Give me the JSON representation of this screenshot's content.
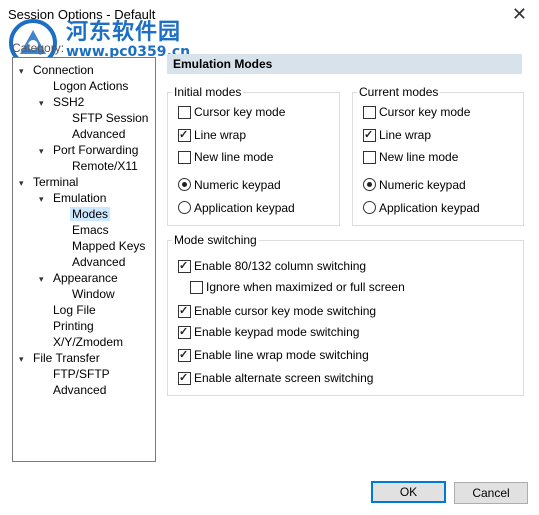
{
  "window": {
    "title": "Session Options - Default",
    "close_glyph": "✕"
  },
  "watermark": {
    "line1": "河东软件园",
    "line2": "www.pc0359.cn"
  },
  "category": {
    "label": "Category:",
    "items": [
      {
        "label": "Connection",
        "level": 0,
        "expander": "▾",
        "selected": false
      },
      {
        "label": "Logon Actions",
        "level": 1,
        "expander": "",
        "selected": false
      },
      {
        "label": "SSH2",
        "level": 1,
        "expander": "▾",
        "selected": false
      },
      {
        "label": "SFTP Session",
        "level": 2,
        "expander": "",
        "selected": false
      },
      {
        "label": "Advanced",
        "level": 2,
        "expander": "",
        "selected": false
      },
      {
        "label": "Port Forwarding",
        "level": 1,
        "expander": "▾",
        "selected": false
      },
      {
        "label": "Remote/X11",
        "level": 2,
        "expander": "",
        "selected": false
      },
      {
        "label": "Terminal",
        "level": 0,
        "expander": "▾",
        "selected": false
      },
      {
        "label": "Emulation",
        "level": 1,
        "expander": "▾",
        "selected": false
      },
      {
        "label": "Modes",
        "level": 2,
        "expander": "",
        "selected": true
      },
      {
        "label": "Emacs",
        "level": 2,
        "expander": "",
        "selected": false
      },
      {
        "label": "Mapped Keys",
        "level": 2,
        "expander": "",
        "selected": false
      },
      {
        "label": "Advanced",
        "level": 2,
        "expander": "",
        "selected": false
      },
      {
        "label": "Appearance",
        "level": 1,
        "expander": "▾",
        "selected": false
      },
      {
        "label": "Window",
        "level": 2,
        "expander": "",
        "selected": false
      },
      {
        "label": "Log File",
        "level": 1,
        "expander": "",
        "selected": false
      },
      {
        "label": "Printing",
        "level": 1,
        "expander": "",
        "selected": false
      },
      {
        "label": "X/Y/Zmodem",
        "level": 1,
        "expander": "",
        "selected": false
      },
      {
        "label": "File Transfer",
        "level": 0,
        "expander": "▾",
        "selected": false
      },
      {
        "label": "FTP/SFTP",
        "level": 1,
        "expander": "",
        "selected": false
      },
      {
        "label": "Advanced",
        "level": 1,
        "expander": "",
        "selected": false
      }
    ]
  },
  "panel": {
    "header": "Emulation Modes"
  },
  "initial_modes": {
    "title": "Initial modes",
    "cursor_key_mode": {
      "label": "Cursor key mode",
      "checked": false
    },
    "line_wrap": {
      "label": "Line wrap",
      "checked": true
    },
    "new_line_mode": {
      "label": "New line mode",
      "checked": false
    },
    "numeric_keypad": {
      "label": "Numeric keypad",
      "selected": true
    },
    "application_keypad": {
      "label": "Application keypad",
      "selected": false
    }
  },
  "current_modes": {
    "title": "Current modes",
    "cursor_key_mode": {
      "label": "Cursor key mode",
      "checked": false
    },
    "line_wrap": {
      "label": "Line wrap",
      "checked": true
    },
    "new_line_mode": {
      "label": "New line mode",
      "checked": false
    },
    "numeric_keypad": {
      "label": "Numeric keypad",
      "selected": true
    },
    "application_keypad": {
      "label": "Application keypad",
      "selected": false
    }
  },
  "mode_switching": {
    "title": "Mode switching",
    "column_switching": {
      "label": "Enable 80/132 column switching",
      "checked": true
    },
    "ignore_maximized": {
      "label": "Ignore when maximized or full screen",
      "checked": false
    },
    "cursor_key_switching": {
      "label": "Enable cursor key mode switching",
      "checked": true
    },
    "keypad_switching": {
      "label": "Enable keypad mode switching",
      "checked": true
    },
    "line_wrap_switching": {
      "label": "Enable line wrap mode switching",
      "checked": true
    },
    "alt_screen_switching": {
      "label": "Enable alternate screen switching",
      "checked": true
    }
  },
  "buttons": {
    "ok": "OK",
    "cancel": "Cancel"
  },
  "colors": {
    "accent": "#0078d7",
    "header_bg": "#d8e2ea",
    "watermark": "#1d6fc4",
    "selection": "#cce8ff"
  }
}
